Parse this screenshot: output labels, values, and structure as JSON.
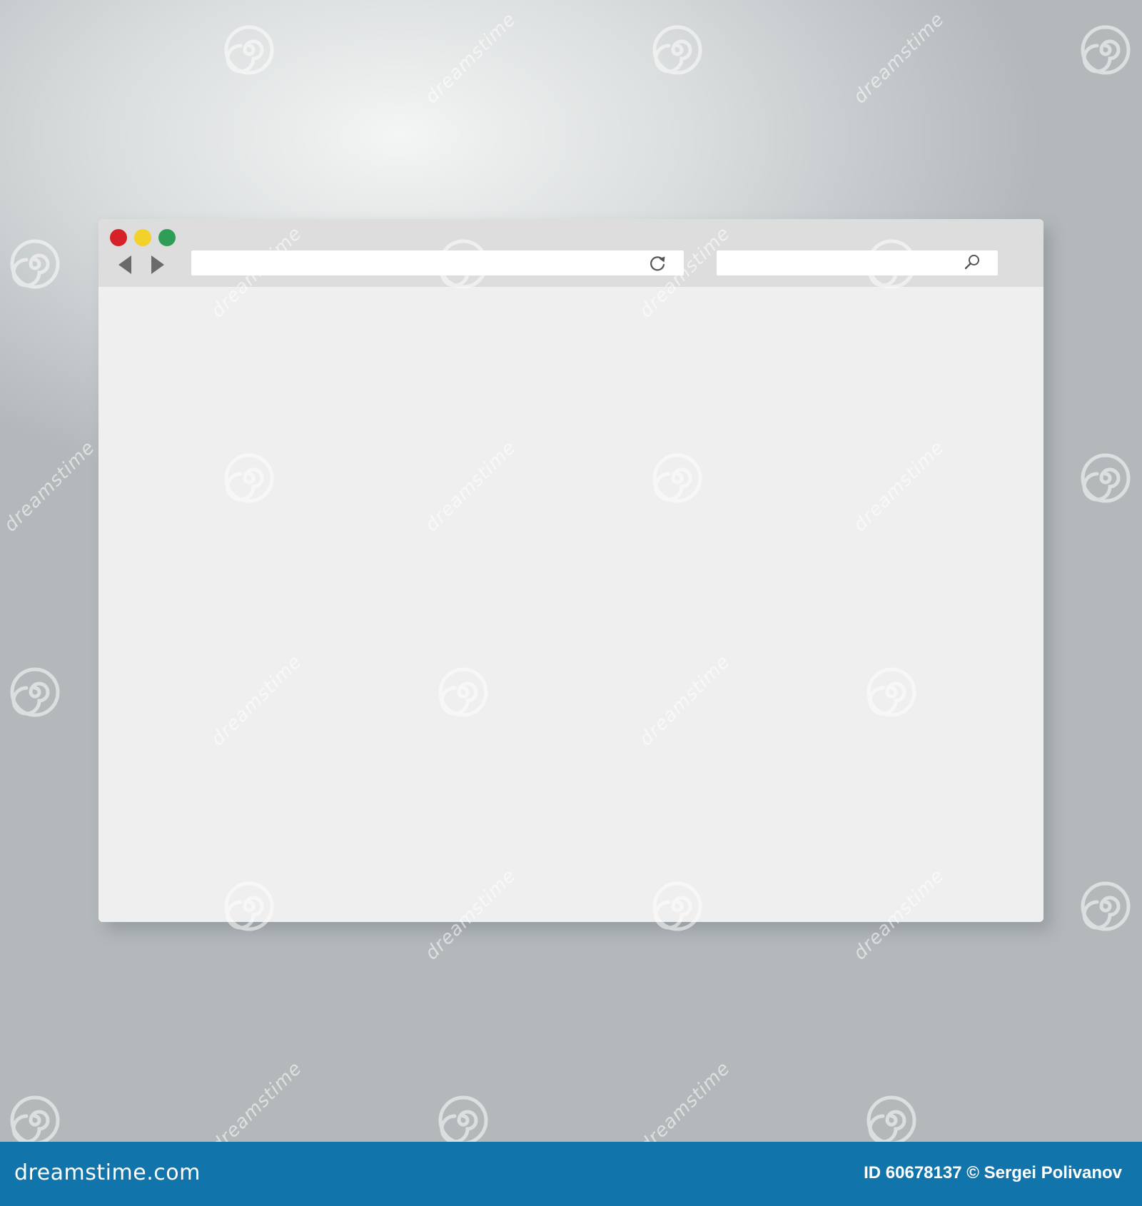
{
  "browser": {
    "address_bar": {
      "value": "",
      "placeholder": ""
    },
    "search_box": {
      "value": "",
      "placeholder": ""
    },
    "traffic_light_colors": {
      "close": "#d72128",
      "minimize": "#f2d12b",
      "maximize": "#2e9d57"
    },
    "icons": {
      "back": "triangle-left-icon",
      "forward": "triangle-right-icon",
      "reload": "reload-icon",
      "search": "magnifier-icon"
    }
  },
  "footer": {
    "logo_text": "dreamstime.com",
    "credit_text": "ID 60678137 © Sergei Polivanov",
    "background_color": "#1174ab"
  },
  "watermark": {
    "text": "dreamstime"
  }
}
